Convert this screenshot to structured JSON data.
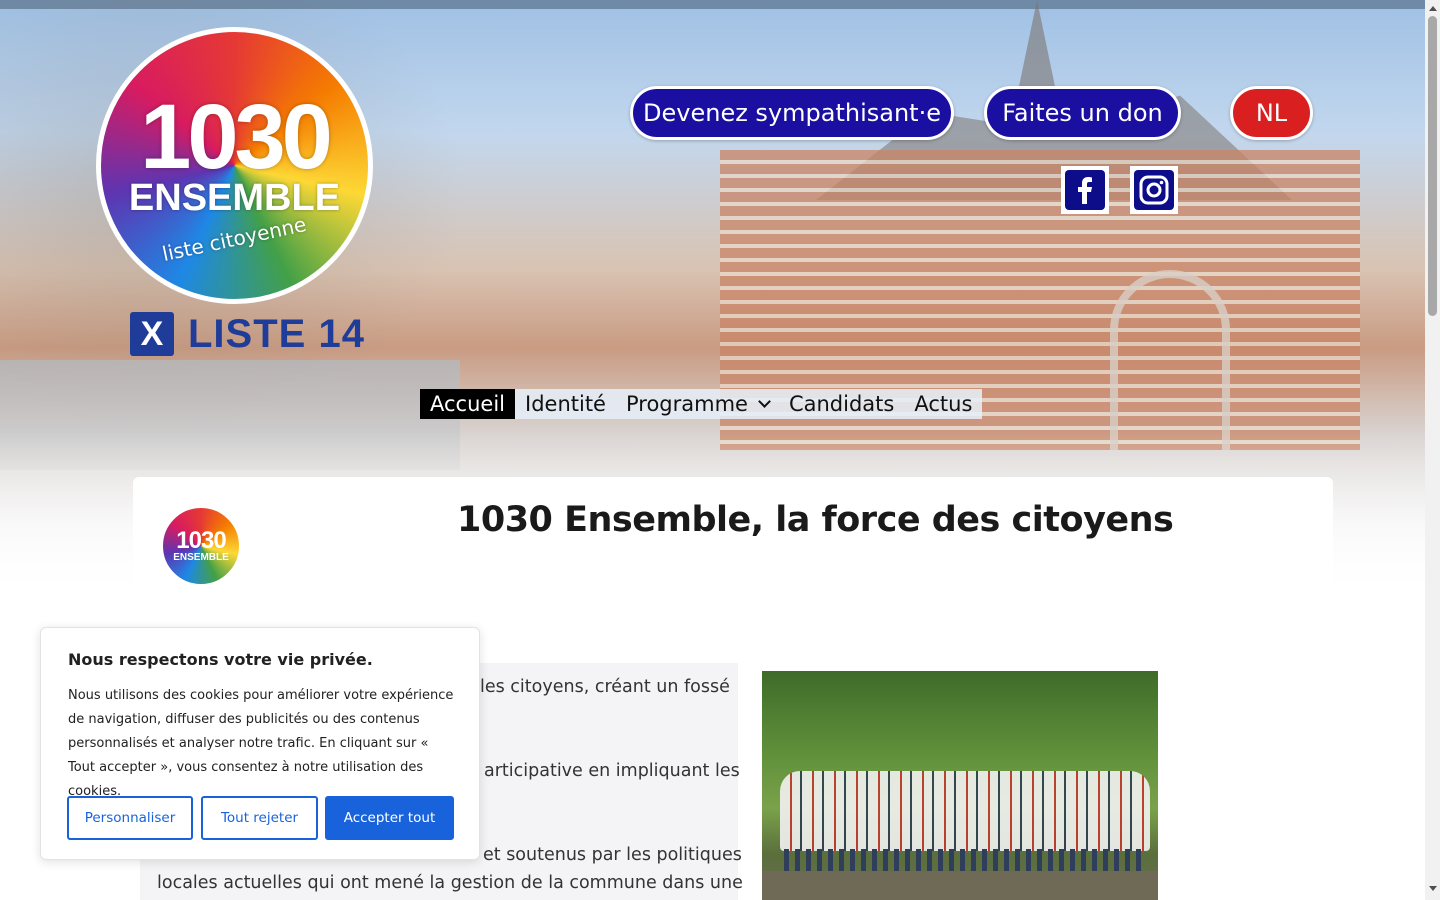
{
  "logo": {
    "number": "1030",
    "word": "ENSEMBLE",
    "tagline": "liste citoyenne",
    "alt": "1030 Ensemble logo"
  },
  "liste": {
    "mark": "X",
    "label": "LISTE 14"
  },
  "header": {
    "supporter_button": "Devenez sympathisant·e",
    "donate_button": "Faites un don",
    "language_button": "NL",
    "social": [
      {
        "icon": "facebook-icon",
        "label": "Facebook"
      },
      {
        "icon": "instagram-icon",
        "label": "Instagram"
      }
    ]
  },
  "nav": {
    "items": [
      {
        "label": "Accueil",
        "active": true
      },
      {
        "label": "Identité",
        "active": false
      },
      {
        "label": "Programme",
        "active": false,
        "has_dropdown": true
      },
      {
        "label": "Candidats",
        "active": false
      },
      {
        "label": "Actus",
        "active": false
      }
    ]
  },
  "main": {
    "title": "1030 Ensemble, la force des citoyens",
    "card_logo": {
      "number": "1030",
      "word": "ENSEMBLE"
    },
    "paragraphs": [
      "les citoyens, créant un fossé",
      "articipative en impliquant les",
      "et soutenus par les politiques",
      "locales actuelles qui ont mené la gestion de la commune dans une"
    ]
  },
  "cookie": {
    "title": "Nous respectons votre vie privée.",
    "body": "Nous utilisons des cookies pour améliorer votre expérience de navigation, diffuser des publicités ou des contenus personnalisés et analyser notre trafic. En cliquant sur « Tout accepter », vous consentez à notre utilisation des cookies.",
    "customize_button": "Personnaliser",
    "reject_button": "Tout rejeter",
    "accept_button": "Accepter tout"
  },
  "colors": {
    "brand_blue": "#1a0fa0",
    "nl_red": "#d91f1f",
    "cookie_blue": "#1863dc",
    "nav_active_bg": "#000000"
  }
}
